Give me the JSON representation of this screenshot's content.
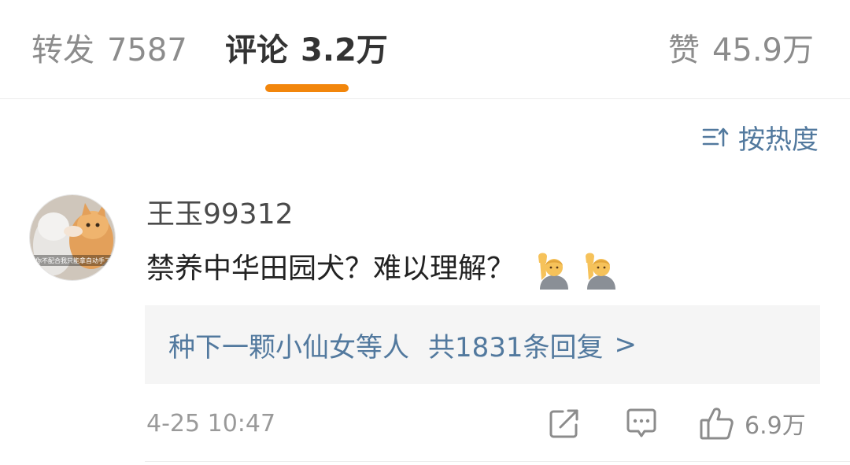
{
  "tabs": {
    "repost": {
      "label": "转发",
      "count": "7587"
    },
    "comments": {
      "label": "评论",
      "count": "3.2万"
    },
    "likes": {
      "label": "赞",
      "count": "45.9万"
    }
  },
  "sort": {
    "label": "按热度",
    "icon": "sort-icon"
  },
  "comment": {
    "avatar_caption": "你不配合我只能拿自动手了",
    "username": "王玉99312",
    "text": "禁养中华田园犬？难以理解？",
    "emojis": [
      "raising-hand-emoji",
      "raising-hand-emoji"
    ],
    "replies": {
      "names": "种下一颗小仙女等人",
      "summary": "共1831条回复",
      "chevron": ">"
    },
    "time": "4-25 10:47",
    "like_count": "6.9万"
  },
  "colors": {
    "accent_underline": "#f2860c",
    "link_blue": "#52799e",
    "muted": "#8c8c8c"
  }
}
